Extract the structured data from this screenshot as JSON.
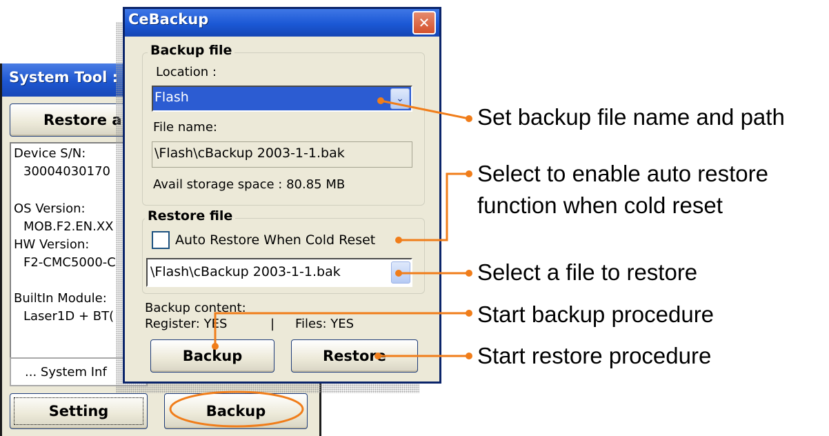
{
  "colors": {
    "accent_orange": "#f07d1a",
    "titlebar_blue": "#1d56d0",
    "window_face": "#ece9d8",
    "selection_blue": "#2c5cd2"
  },
  "back_window": {
    "title": "System Tool :",
    "restore_all_label": "Restore al",
    "info": {
      "device_sn_label": "Device S/N:",
      "device_sn_value": "30004030170",
      "os_version_label": "OS Version:",
      "os_version_value": "MOB.F2.EN.XX",
      "hw_version_label": "HW Version:",
      "hw_version_value": "F2-CMC5000-C",
      "builtin_module_label": "BuiltIn Module:",
      "builtin_module_value": "Laser1D + BT("
    },
    "system_info_label": "... System Inf",
    "setting_label": "Setting",
    "backup_label": "Backup"
  },
  "dialog": {
    "title": "CeBackup",
    "close_icon": "close-x",
    "backup_file": {
      "group_title": "Backup file",
      "location_label": "Location :",
      "location_value": "Flash",
      "file_name_label": "File name:",
      "file_name_value": "\\Flash\\cBackup 2003-1-1.bak",
      "avail_storage": "Avail storage space : 80.85 MB"
    },
    "restore_file": {
      "group_title": "Restore file",
      "auto_restore_label": "Auto Restore When Cold Reset",
      "restore_value": "\\Flash\\cBackup 2003-1-1.bak"
    },
    "backup_content": {
      "label": "Backup content:",
      "register": "Register: YES",
      "separator": "|",
      "files": "Files: YES"
    },
    "backup_button": "Backup",
    "restore_button": "Restore"
  },
  "annotations": {
    "set_backup_path": "Set backup file name and path",
    "auto_restore_line1": "Select to enable auto restore",
    "auto_restore_line2": "function when cold reset",
    "select_restore": "Select a file to restore",
    "start_backup": "Start backup procedure",
    "start_restore": "Start restore procedure"
  }
}
